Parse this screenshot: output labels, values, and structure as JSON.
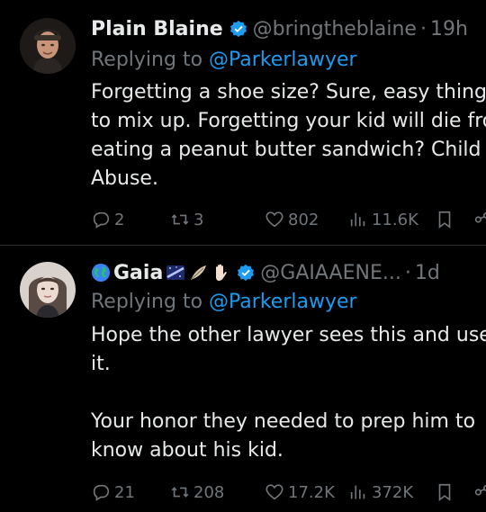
{
  "tweets": [
    {
      "name": "Plain Blaine",
      "handle": "@bringtheblaine",
      "separator": "·",
      "time": "19h",
      "replying_prefix": "Replying to ",
      "replying_to": "@Parkerlawyer",
      "text": "Forgetting a shoe size? Sure, easy thing\nto mix up. Forgetting your kid will die fro\neating a peanut butter sandwich? Child\nAbuse.",
      "replies": "2",
      "retweets": "3",
      "likes": "802",
      "views": "11.6K"
    },
    {
      "name": "Gaia",
      "name_emojis": [
        "globe-icon",
        "milky-way-icon",
        "feather-icon",
        "raised-hand-icon"
      ],
      "handle": "@GAIAAENE...",
      "separator": "·",
      "time": "1d",
      "replying_prefix": "Replying to ",
      "replying_to": "@Parkerlawyer",
      "text": "Hope the other lawyer sees this and use\nit.\n\nYour honor they needed to prep him to\nknow about his kid.",
      "replies": "21",
      "retweets": "208",
      "likes": "17.2K",
      "views": "372K"
    }
  ],
  "colors": {
    "background": "#000000",
    "text": "#e7e9ea",
    "secondary": "#71767b",
    "link": "#1d9bf0",
    "verified": "#1d9bf0",
    "divider": "#2f3336"
  }
}
